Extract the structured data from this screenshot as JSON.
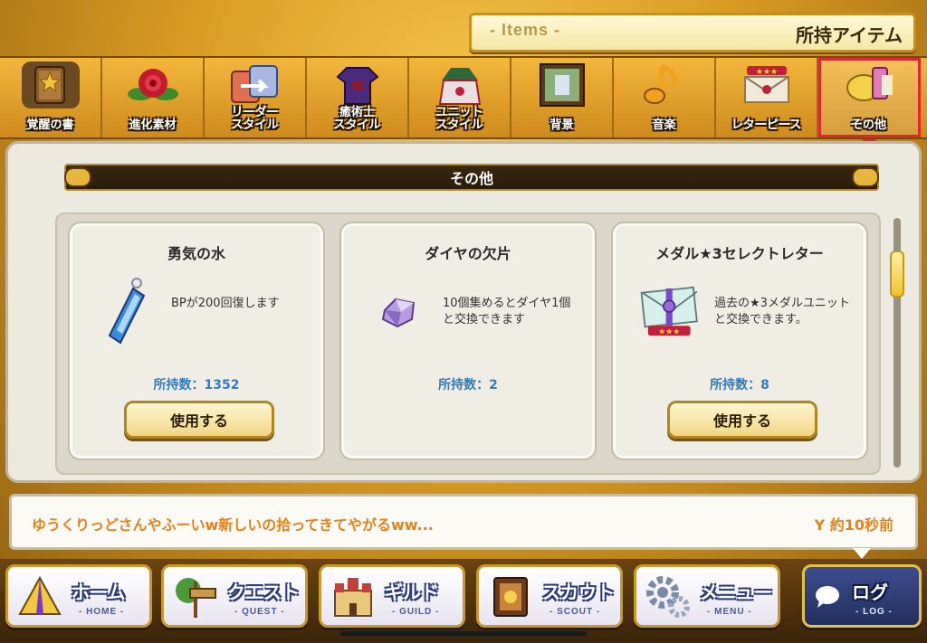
{
  "header": {
    "en_title": "- Items -",
    "jp_title": "所持アイテム"
  },
  "tabs": [
    {
      "label": "覚醒の書",
      "icon": "book-icon",
      "active": false
    },
    {
      "label": "進化素材",
      "icon": "rose-icon",
      "active": false
    },
    {
      "label": "リーダー\nスタイル",
      "icon": "leader-style-icon",
      "active": false
    },
    {
      "label": "癒術士\nスタイル",
      "icon": "healer-outfit-icon",
      "active": false
    },
    {
      "label": "ユニット\nスタイル",
      "icon": "unit-outfit-icon",
      "active": false
    },
    {
      "label": "背景",
      "icon": "background-picture-icon",
      "active": false
    },
    {
      "label": "音楽",
      "icon": "music-note-icon",
      "active": false
    },
    {
      "label": "レターピース",
      "icon": "letter-icon",
      "active": false
    },
    {
      "label": "その他",
      "icon": "other-items-icon",
      "active": true
    }
  ],
  "section": {
    "title": "その他"
  },
  "items": [
    {
      "name": "勇気の水",
      "icon": "blue-potion-icon",
      "description": "BPが200回復します",
      "count_label": "所持数：1352",
      "button": "使用する",
      "has_button": true
    },
    {
      "name": "ダイヤの欠片",
      "icon": "diamond-shard-icon",
      "description": "10個集めるとダイヤ1個と交換できます",
      "count_label": "所持数：2",
      "button": "",
      "has_button": false
    },
    {
      "name": "メダル★3セレクトレター",
      "icon": "select-letter-icon",
      "description": "過去の★3メダルユニットと交換できます。",
      "count_label": "所持数：8",
      "button": "使用する",
      "has_button": true
    }
  ],
  "chat": {
    "message": "ゆうくりっどさんやふーいw新しいの拾ってきてやがるww...",
    "time": "Y  約10秒前"
  },
  "nav": [
    {
      "label": "ホーム",
      "sub": "- HOME -",
      "icon": "tent-icon",
      "active": false
    },
    {
      "label": "クエスト",
      "sub": "- QUEST -",
      "icon": "signpost-icon",
      "active": false
    },
    {
      "label": "ギルド",
      "sub": "- GUILD -",
      "icon": "castle-icon",
      "active": false
    },
    {
      "label": "スカウト",
      "sub": "- SCOUT -",
      "icon": "scout-book-icon",
      "active": false
    },
    {
      "label": "メニュー",
      "sub": "- MENU -",
      "icon": "gear-icon",
      "active": false
    },
    {
      "label": "ログ",
      "sub": "- LOG -",
      "icon": "chat-bubble-icon",
      "active": true
    }
  ],
  "colors": {
    "accent_gold": "#c88f1c",
    "active_tab_border": "#e0262f",
    "count_blue": "#2e7cc2",
    "chat_orange": "#e6821c",
    "nav_active": "#3c4d8e"
  }
}
